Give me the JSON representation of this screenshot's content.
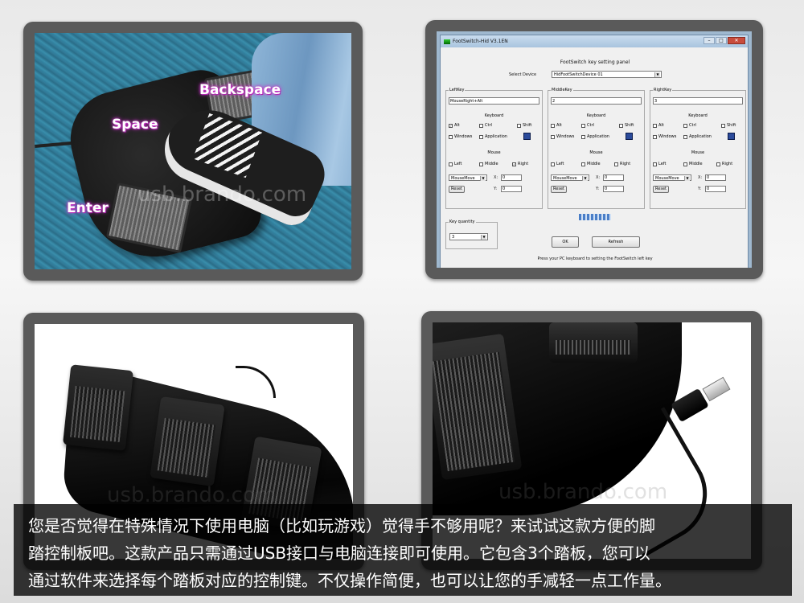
{
  "photo_labels": {
    "backspace": "Backspace",
    "space": "Space",
    "enter": "Enter"
  },
  "watermark": "usb.brando.com",
  "software": {
    "window_title": "FootSwitch-Hid V3.1EN",
    "panel_title": "FootSwitch key setting panel",
    "select_device_label": "Select Device",
    "device_value": "HidFootSwitchDevice 01",
    "groups": [
      {
        "title": "LeftKey",
        "text": "MouseRight+Alt",
        "keyboard": "Keyboard",
        "mouse": "Mouse",
        "alt_checked": true,
        "right_checked": true,
        "mousemove": "MouseMove",
        "x": "0",
        "y": "0",
        "reset": "Reset"
      },
      {
        "title": "MiddleKey",
        "text": "2",
        "keyboard": "Keyboard",
        "mouse": "Mouse",
        "alt_checked": false,
        "right_checked": false,
        "mousemove": "MouseMove",
        "x": "0",
        "y": "0",
        "reset": "Reset"
      },
      {
        "title": "RightKey",
        "text": "3",
        "keyboard": "Keyboard",
        "mouse": "Mouse",
        "alt_checked": false,
        "right_checked": false,
        "mousemove": "MouseMove",
        "x": "0",
        "y": "0",
        "reset": "Reset"
      }
    ],
    "kb_labels": {
      "alt": "Alt",
      "ctrl": "Ctrl",
      "shift": "Shift",
      "windows": "Windows",
      "application": "Application"
    },
    "mouse_labels": {
      "left": "Left",
      "middle": "Middle",
      "right": "Right"
    },
    "xy_labels": {
      "x": "X:",
      "y": "Y:"
    },
    "key_quantity_label": "Key quantity",
    "key_quantity_value": "3",
    "ok_label": "OK",
    "refresh_label": "Refresh",
    "status_text": "Press your PC keyboard to setting the FootSwitch left key"
  },
  "caption": {
    "line1": "您是否觉得在特殊情况下使用电脑（比如玩游戏）觉得手不够用呢？来试试这款方便的脚",
    "line2": "踏控制板吧。这款产品只需通过USB接口与电脑连接即可使用。它包含3个踏板，您可以",
    "line3": "通过软件来选择每个踏板对应的控制键。不仅操作简便，也可以让您的手减轻一点工作量。"
  }
}
